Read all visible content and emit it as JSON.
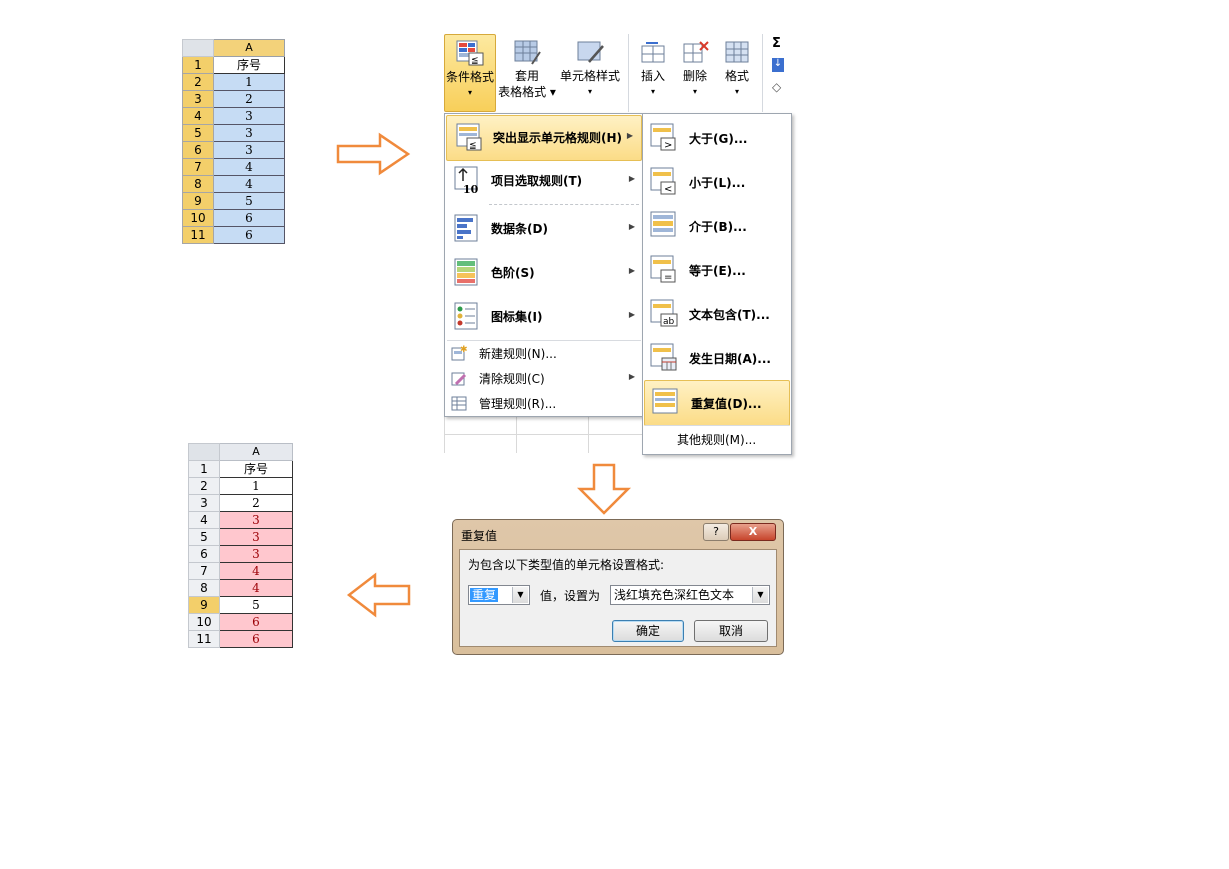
{
  "sheet_before": {
    "col_header": "A",
    "row_numbers": [
      "1",
      "2",
      "3",
      "4",
      "5",
      "6",
      "7",
      "8",
      "9",
      "10",
      "11"
    ],
    "values": [
      "序号",
      "1",
      "2",
      "3",
      "3",
      "3",
      "4",
      "4",
      "5",
      "6",
      "6"
    ]
  },
  "ribbon": {
    "buttons": [
      {
        "label1": "条件格式",
        "label2": "▾"
      },
      {
        "label1": "套用",
        "label2": "表格格式 ▾"
      },
      {
        "label1": "单元格样式",
        "label2": "▾"
      },
      {
        "label1": "插入",
        "label2": "▾"
      },
      {
        "label1": "删除",
        "label2": "▾"
      },
      {
        "label1": "格式",
        "label2": "▾"
      }
    ],
    "edge_glyphs": [
      "Σ",
      "↓",
      "◇"
    ]
  },
  "menu": {
    "items": [
      {
        "label": "突出显示单元格规则(H)"
      },
      {
        "label": "项目选取规则(T)"
      },
      {
        "label": "数据条(D)"
      },
      {
        "label": "色阶(S)"
      },
      {
        "label": "图标集(I)"
      }
    ],
    "small_items": [
      {
        "label": "新建规则(N)..."
      },
      {
        "label": "清除规则(C)"
      },
      {
        "label": "管理规则(R)..."
      }
    ]
  },
  "submenu": {
    "items": [
      {
        "label": "大于(G)..."
      },
      {
        "label": "小于(L)..."
      },
      {
        "label": "介于(B)..."
      },
      {
        "label": "等于(E)..."
      },
      {
        "label": "文本包含(T)..."
      },
      {
        "label": "发生日期(A)..."
      },
      {
        "label": "重复值(D)..."
      }
    ],
    "footer": "其他规则(M)..."
  },
  "dialog": {
    "title": "重复值",
    "help": "?",
    "close": "X",
    "prompt": "为包含以下类型值的单元格设置格式:",
    "type_value": "重复",
    "middle_label": "值，设置为",
    "format_value": "浅红填充色深红色文本",
    "ok": "确定",
    "cancel": "取消"
  },
  "sheet_after": {
    "col_header": "A",
    "row_numbers": [
      "1",
      "2",
      "3",
      "4",
      "5",
      "6",
      "7",
      "8",
      "9",
      "10",
      "11"
    ],
    "values": [
      "序号",
      "1",
      "2",
      "3",
      "3",
      "3",
      "4",
      "4",
      "5",
      "6",
      "6"
    ],
    "duplicate_fill": "#ffc7ce",
    "duplicate_text": "#9c0006"
  },
  "colors": {
    "arrow": "#f08a3c",
    "accent": "#f8cf5a"
  }
}
